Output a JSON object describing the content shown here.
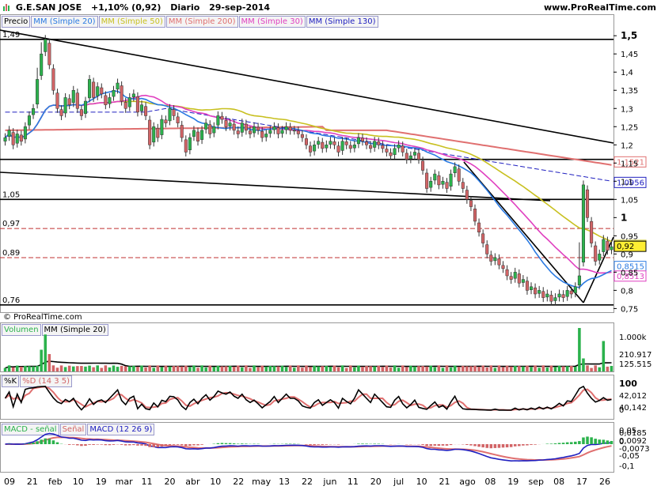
{
  "header": {
    "symbol": "G.E.SAN JOSE",
    "change": "+1,10% (0,92)",
    "period": "Diario",
    "date": "29-sep-2014",
    "site": "www.ProRealTime.com"
  },
  "copyright": "© ProRealTime.com",
  "legends": {
    "price": [
      "Precio",
      "MM (Simple 20)",
      "MM (Simple 50)",
      "MM (Simple 200)",
      "MM (Simple 30)",
      "MM (Simple 130)"
    ],
    "volume": [
      "Volumen",
      "MM (Simple 20)"
    ],
    "stoch": [
      "%K",
      "%D (14 3 5)"
    ],
    "macd": [
      "MACD - señal",
      "Señal",
      "MACD (12 26 9)"
    ]
  },
  "colors": {
    "up": "#2bb24c",
    "down": "#d26466",
    "sma20": "#2a7ae2",
    "sma50": "#c8c020",
    "sma200": "#e07070",
    "sma30": "#e040c0",
    "sma130": "#2020c0"
  },
  "chart_data": [
    {
      "type": "candlestick",
      "panel": "price",
      "ylim": [
        0.74,
        1.52
      ],
      "y_ticks": [
        0.75,
        0.8,
        0.85,
        0.9,
        0.95,
        1,
        1.05,
        1.1,
        1.15,
        1.2,
        1.25,
        1.3,
        1.35,
        1.4,
        1.45,
        1.5
      ],
      "y_tick_labels": [
        "0,75",
        "0,8",
        "0,85",
        "0,9",
        "0,95",
        "1",
        "1,05",
        "1,1",
        "1,15",
        "1,2",
        "1,25",
        "1,3",
        "1,35",
        "1,4",
        "1,45",
        "1,5"
      ],
      "x_ticks": [
        "09",
        "21",
        "feb",
        "10",
        "19",
        "mar",
        "11",
        "20",
        "abr",
        "10",
        "22",
        "may",
        "13",
        "22",
        "jun",
        "11",
        "20",
        "jul",
        "10",
        "21",
        "ago",
        "08",
        "19",
        "sep",
        "08",
        "17",
        "26"
      ],
      "horizontal_levels": [
        {
          "value": 1.49,
          "label": "1,49",
          "style": "solid"
        },
        {
          "value": 1.16,
          "label": "",
          "style": "solid"
        },
        {
          "value": 1.05,
          "label": "1,05",
          "style": "solid"
        },
        {
          "value": 0.97,
          "label": "0,97",
          "style": "dashed"
        },
        {
          "value": 0.89,
          "label": "0,89",
          "style": "dashed"
        },
        {
          "value": 0.76,
          "label": "0,76",
          "style": "solid"
        }
      ],
      "price_labels": [
        {
          "value": 1.1521,
          "label": "1,1521",
          "series": "sma200"
        },
        {
          "value": 1.0956,
          "label": "1,0956",
          "series": "sma130"
        },
        {
          "value": 0.9226,
          "label": "0,9226",
          "series": "sma50"
        },
        {
          "value": 0.92,
          "label": "0,92",
          "series": "close"
        },
        {
          "value": 0.8515,
          "label": "0,8515",
          "series": "sma20"
        },
        {
          "value": 0.8513,
          "label": "0,8513",
          "series": "sma30"
        }
      ],
      "close": [
        1.22,
        1.24,
        1.2,
        1.23,
        1.21,
        1.25,
        1.28,
        1.3,
        1.38,
        1.45,
        1.49,
        1.42,
        1.35,
        1.3,
        1.28,
        1.33,
        1.31,
        1.35,
        1.3,
        1.28,
        1.32,
        1.38,
        1.33,
        1.36,
        1.34,
        1.31,
        1.33,
        1.35,
        1.37,
        1.32,
        1.3,
        1.33,
        1.34,
        1.29,
        1.31,
        1.28,
        1.2,
        1.25,
        1.22,
        1.27,
        1.26,
        1.3,
        1.28,
        1.26,
        1.22,
        1.18,
        1.22,
        1.24,
        1.21,
        1.24,
        1.26,
        1.23,
        1.25,
        1.28,
        1.27,
        1.25,
        1.26,
        1.24,
        1.23,
        1.26,
        1.24,
        1.23,
        1.25,
        1.24,
        1.22,
        1.23,
        1.24,
        1.25,
        1.23,
        1.24,
        1.25,
        1.24,
        1.24,
        1.23,
        1.22,
        1.2,
        1.18,
        1.2,
        1.21,
        1.19,
        1.2,
        1.21,
        1.2,
        1.18,
        1.21,
        1.2,
        1.19,
        1.2,
        1.22,
        1.21,
        1.2,
        1.19,
        1.21,
        1.2,
        1.19,
        1.18,
        1.17,
        1.19,
        1.2,
        1.18,
        1.16,
        1.17,
        1.18,
        1.16,
        1.13,
        1.08,
        1.1,
        1.12,
        1.09,
        1.1,
        1.08,
        1.12,
        1.14,
        1.1,
        1.08,
        1.05,
        1.03,
        0.99,
        0.96,
        0.93,
        0.9,
        0.88,
        0.89,
        0.87,
        0.86,
        0.84,
        0.83,
        0.85,
        0.82,
        0.83,
        0.8,
        0.81,
        0.79,
        0.8,
        0.78,
        0.79,
        0.77,
        0.78,
        0.79,
        0.78,
        0.8,
        0.79,
        0.81,
        0.84,
        1.09,
        1.0,
        0.93,
        0.88,
        0.9,
        0.94,
        0.91,
        0.92
      ]
    },
    {
      "type": "bar",
      "panel": "volume",
      "y_tick_labels": [
        "1.000k"
      ],
      "last_labels": [
        "210.917",
        "125.515"
      ]
    },
    {
      "type": "line",
      "panel": "stochastic",
      "y_tick_labels": [
        "100",
        "50",
        "0"
      ],
      "last_labels": [
        "42,012",
        "40,142"
      ]
    },
    {
      "type": "line",
      "panel": "macd",
      "y_tick_labels": [
        "0,05",
        "0",
        "-0,05",
        "-0,1"
      ],
      "last_labels": [
        "0,0185",
        "0,0092",
        "-0,0073"
      ]
    }
  ]
}
